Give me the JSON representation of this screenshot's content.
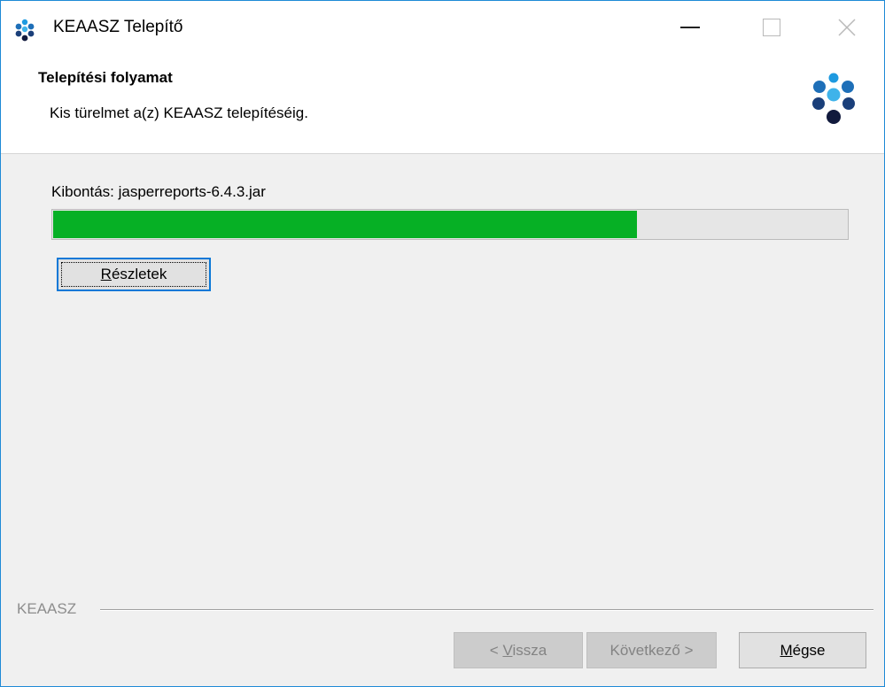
{
  "window": {
    "title": "KEAASZ Telepítő",
    "accent_color": "#1e8ad6",
    "icon": "keaasz-logo-icon"
  },
  "titlebar_controls": {
    "minimize_icon": "minimize-icon",
    "maximize_icon": "maximize-icon",
    "close_icon": "close-icon"
  },
  "header": {
    "title": "Telepítési folyamat",
    "subtitle": "Kis türelmet a(z) KEAASZ telepítéséig.",
    "logo_icon": "keaasz-logo-icon"
  },
  "progress": {
    "status_text": "Kibontás: jasperreports-6.4.3.jar",
    "percent": 73.5,
    "fill_color": "#06b025"
  },
  "details_button": {
    "label_mnemonic": "R",
    "label_rest": "észletek"
  },
  "footer": {
    "brand": "KEAASZ",
    "back": {
      "prefix": "< ",
      "mnemonic": "V",
      "rest": "issza",
      "enabled": false
    },
    "next": {
      "label": "Következő >",
      "enabled": false
    },
    "cancel": {
      "mnemonic": "M",
      "rest": "égse",
      "enabled": true
    }
  }
}
